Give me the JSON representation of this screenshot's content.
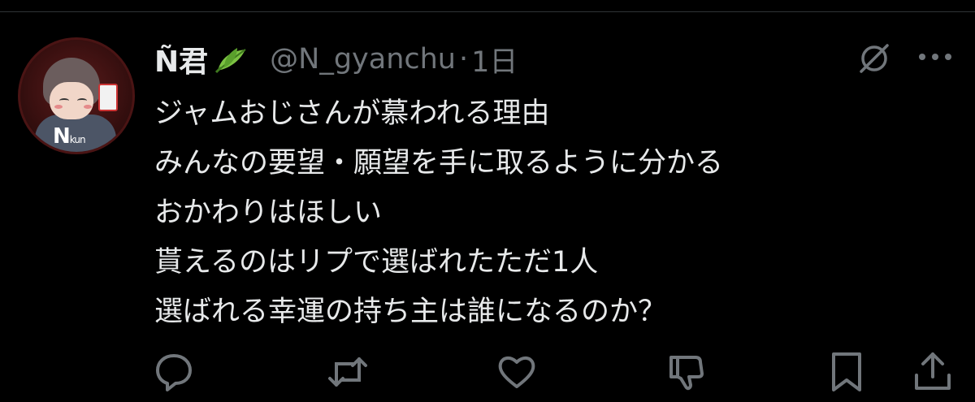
{
  "tweet": {
    "display_name": "Ñ君",
    "name_emoji_icon": "leaf-icon",
    "handle": "@N_gyanchu",
    "separator": "·",
    "time": "1日",
    "lines": [
      "ジャムおじさんが慕われる理由",
      "みんなの要望・願望を手に取るように分かる",
      "おかわりはほしい",
      "貰えるのはリプで選ばれたただ1人",
      "選ばれる幸運の持ち主は誰になるのか？"
    ]
  },
  "icons": {
    "grok": "grok-icon",
    "more": "more-icon",
    "actions": [
      "reply-icon",
      "retweet-icon",
      "like-icon",
      "downvote-icon",
      "bookmark-icon",
      "share-icon"
    ]
  },
  "colors": {
    "background": "#000000",
    "text": "#e7e9ea",
    "muted": "#71767b"
  }
}
